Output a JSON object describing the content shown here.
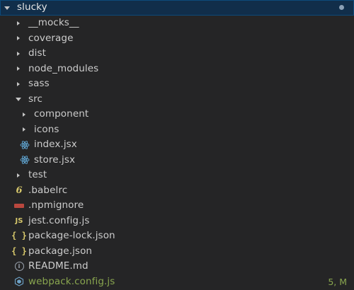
{
  "explorer": {
    "root": {
      "label": "slucky"
    },
    "items": [
      {
        "label": "__mocks__",
        "type": "folder"
      },
      {
        "label": "coverage",
        "type": "folder"
      },
      {
        "label": "dist",
        "type": "folder"
      },
      {
        "label": "node_modules",
        "type": "folder"
      },
      {
        "label": "sass",
        "type": "folder"
      },
      {
        "label": "src",
        "type": "folder-open"
      },
      {
        "label": "component",
        "type": "folder"
      },
      {
        "label": "icons",
        "type": "folder"
      },
      {
        "label": "index.jsx",
        "type": "react-file"
      },
      {
        "label": "store.jsx",
        "type": "react-file"
      },
      {
        "label": "test",
        "type": "folder"
      },
      {
        "label": ".babelrc",
        "type": "babel-file",
        "icon_glyph": "6"
      },
      {
        "label": ".npmignore",
        "type": "npm-file"
      },
      {
        "label": "jest.config.js",
        "type": "js-file",
        "icon_glyph": "JS"
      },
      {
        "label": "package-lock.json",
        "type": "json-file",
        "icon_glyph": "{ }"
      },
      {
        "label": "package.json",
        "type": "json-file",
        "icon_glyph": "{ }"
      },
      {
        "label": "README.md",
        "type": "info-file",
        "icon_glyph": "i"
      },
      {
        "label": "webpack.config.js",
        "type": "webpack-file",
        "status": "5, M"
      }
    ]
  },
  "colors": {
    "background": "#252526",
    "selected_row": "#112e4a",
    "modified_text": "#89a64f",
    "react_icon": "#61a8d6",
    "js_icon": "#d6c76b",
    "npm_icon": "#b9473e",
    "webpack_icon": "#6ea3c8"
  }
}
